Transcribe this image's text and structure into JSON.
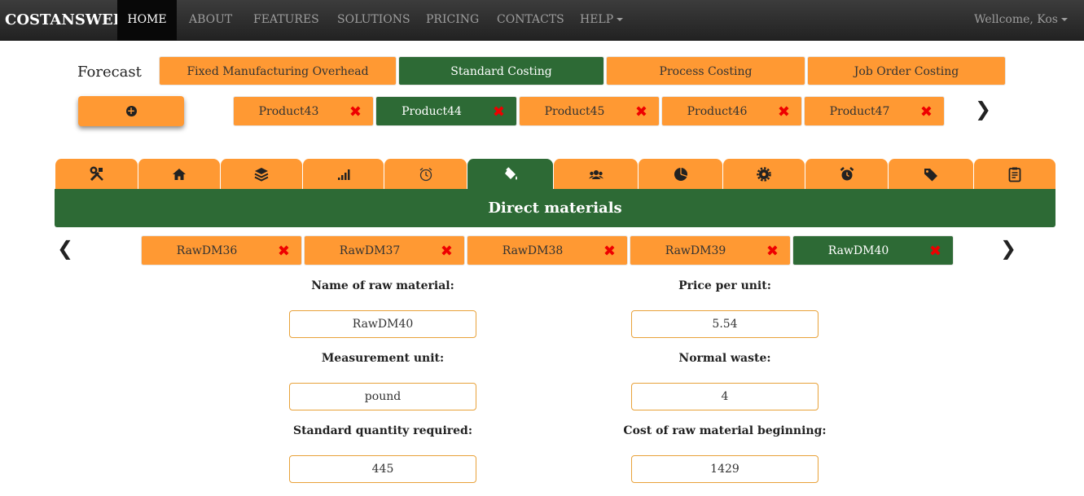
{
  "navbar": {
    "brand": "COSTANSWER",
    "items": [
      {
        "label": "HOME"
      },
      {
        "label": "ABOUT"
      },
      {
        "label": "FEATURES"
      },
      {
        "label": "SOLUTIONS"
      },
      {
        "label": "PRICING"
      },
      {
        "label": "CONTACTS"
      },
      {
        "label": "HELP"
      }
    ],
    "active_item": "HOME",
    "welcome": "Wellcome, Kos"
  },
  "forecast": {
    "label": "Forecast",
    "tabs": [
      {
        "label": "Fixed Manufacturing Overhead"
      },
      {
        "label": "Standard Costing"
      },
      {
        "label": "Process Costing"
      },
      {
        "label": "Job Order Costing"
      }
    ],
    "active_tab": "Standard Costing"
  },
  "products": {
    "add_icon": "plus-circle-icon",
    "items": [
      {
        "label": "Product43"
      },
      {
        "label": "Product44"
      },
      {
        "label": "Product45"
      },
      {
        "label": "Product46"
      },
      {
        "label": "Product47"
      }
    ],
    "active": "Product44"
  },
  "icon_tabs": [
    {
      "icon": "tools-icon"
    },
    {
      "icon": "home-icon"
    },
    {
      "icon": "layers-icon"
    },
    {
      "icon": "signal-bars-icon"
    },
    {
      "icon": "alarm-clock-outline-icon"
    },
    {
      "icon": "paint-bucket-icon"
    },
    {
      "icon": "users-icon"
    },
    {
      "icon": "pie-chart-icon"
    },
    {
      "icon": "gear-icon"
    },
    {
      "icon": "alarm-clock-icon"
    },
    {
      "icon": "tag-icon"
    },
    {
      "icon": "clipboard-icon"
    }
  ],
  "active_icon_tab": "paint-bucket-icon",
  "section_title": "Direct materials",
  "raw_materials": {
    "items": [
      {
        "label": "RawDM36"
      },
      {
        "label": "RawDM37"
      },
      {
        "label": "RawDM38"
      },
      {
        "label": "RawDM39"
      },
      {
        "label": "RawDM40"
      }
    ],
    "active": "RawDM40"
  },
  "form": {
    "name_label": "Name of raw material:",
    "name_value": "RawDM40",
    "price_label": "Price per unit:",
    "price_value": "5.54",
    "unit_label": "Measurement unit:",
    "unit_value": "pound",
    "waste_label": "Normal waste:",
    "waste_value": "4",
    "qty_label": "Standard quantity required:",
    "qty_value": "445",
    "cost_label": "Cost of raw material beginning:",
    "cost_value": "1429"
  },
  "colors": {
    "orange": "#ff9933",
    "green": "#2d6a35",
    "navbar": "#222222",
    "delete": "#ee0000"
  }
}
